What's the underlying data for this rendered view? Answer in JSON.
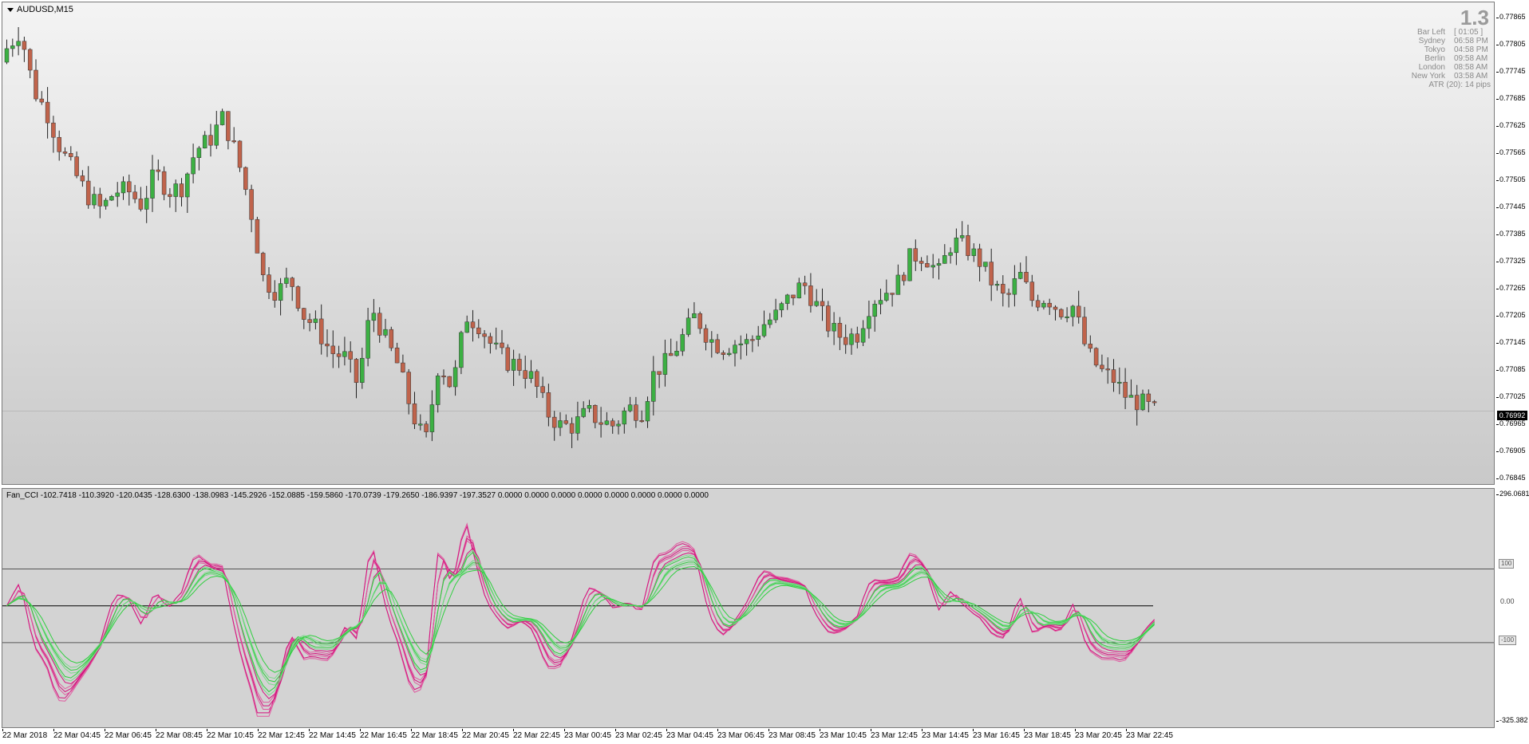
{
  "main": {
    "title": "AUDUSD,M15",
    "current_price": "0.76992",
    "y_ticks": [
      "0.77865",
      "0.77805",
      "0.77745",
      "0.77685",
      "0.77625",
      "0.77565",
      "0.77505",
      "0.77445",
      "0.77385",
      "0.77325",
      "0.77265",
      "0.77205",
      "0.77145",
      "0.77085",
      "0.77025",
      "0.76965",
      "0.76905",
      "0.76845"
    ]
  },
  "info": {
    "big": "1.3",
    "rows": [
      {
        "label": "Bar Left",
        "value": "[ 01:05 ]"
      },
      {
        "label": "Sydney",
        "value": "06:58 PM"
      },
      {
        "label": "Tokyo",
        "value": "04:58 PM"
      },
      {
        "label": "Berlin",
        "value": "09:58 AM"
      },
      {
        "label": "London",
        "value": "08:58 AM"
      },
      {
        "label": "New York",
        "value": "03:58 AM"
      }
    ],
    "atr": "ATR (20): 14 pips"
  },
  "indicator": {
    "title": "Fan_CCI -102.7418 -110.3920 -120.0435 -128.6300 -138.0983 -145.2926 -152.0885 -159.5860 -170.0739 -179.2650 -186.9397 -197.3527 0.0000 0.0000 0.0000 0.0000 0.0000 0.0000 0.0000 0.0000",
    "top_value": "296.0681",
    "bottom_value": "-325.382",
    "level_plus": "100",
    "level_zero": "0.00",
    "level_minus": "-100"
  },
  "x_labels": [
    "22 Mar 2018",
    "22 Mar 04:45",
    "22 Mar 06:45",
    "22 Mar 08:45",
    "22 Mar 10:45",
    "22 Mar 12:45",
    "22 Mar 14:45",
    "22 Mar 16:45",
    "22 Mar 18:45",
    "22 Mar 20:45",
    "22 Mar 22:45",
    "23 Mar 00:45",
    "23 Mar 02:45",
    "23 Mar 04:45",
    "23 Mar 06:45",
    "23 Mar 08:45",
    "23 Mar 10:45",
    "23 Mar 12:45",
    "23 Mar 14:45",
    "23 Mar 16:45",
    "23 Mar 18:45",
    "23 Mar 20:45",
    "23 Mar 22:45"
  ],
  "colors": {
    "bull": "#3cb043",
    "bear": "#c0634b",
    "cci_pink": "#d4127e",
    "cci_green": "#2fcf3f"
  },
  "chart_data": {
    "type": "candlestick",
    "close_path": [
      0.7778,
      0.7782,
      0.7769,
      0.7764,
      0.7756,
      0.7751,
      0.7746,
      0.7743,
      0.7747,
      0.7747,
      0.7744,
      0.7751,
      0.7747,
      0.7748,
      0.7756,
      0.7758,
      0.7763,
      0.7755,
      0.7744,
      0.7728,
      0.7725,
      0.7728,
      0.772,
      0.7717,
      0.7712,
      0.7711,
      0.7705,
      0.7722,
      0.7715,
      0.7709,
      0.7699,
      0.7692,
      0.771,
      0.7704,
      0.772,
      0.7718,
      0.7713,
      0.771,
      0.7709,
      0.7706,
      0.7699,
      0.7696,
      0.7696,
      0.7699,
      0.7697,
      0.7696,
      0.77,
      0.7699,
      0.7708,
      0.771,
      0.7715,
      0.772,
      0.7715,
      0.7713,
      0.7714,
      0.7714,
      0.7718,
      0.772,
      0.7724,
      0.7727,
      0.7722,
      0.7717,
      0.7715,
      0.7716,
      0.7723,
      0.7725,
      0.7727,
      0.7733,
      0.7733,
      0.7729,
      0.7736,
      0.7735,
      0.7732,
      0.7727,
      0.7723,
      0.7729,
      0.7723,
      0.7724,
      0.7721,
      0.7722,
      0.7712,
      0.7708,
      0.7706,
      0.7702,
      0.7701,
      0.76992
    ]
  }
}
